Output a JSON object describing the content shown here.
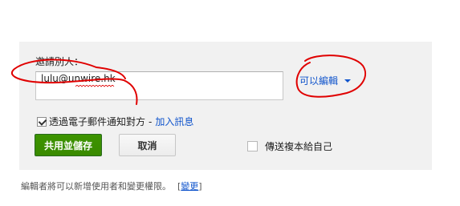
{
  "share_dialog": {
    "invite_label": "邀請別人：",
    "invite_value": "lulu@unwire.hk",
    "permission_selected": "可以編輯",
    "notify": {
      "checked": true,
      "label": "透過電子郵件通知對方",
      "separator": "-",
      "add_message_link": "加入訊息"
    },
    "share_save_button": "共用並儲存",
    "cancel_button": "取消",
    "send_copy": {
      "checked": false,
      "label": "傳送複本給自己"
    },
    "footer": {
      "text": "編輯者將可以新增使用者和變更權限。",
      "bracket_open": "[",
      "change_link": "變更",
      "bracket_close": "]"
    }
  },
  "colors": {
    "link": "#1155cc",
    "primary_button": "#3d9400",
    "annotation": "#e00000"
  }
}
